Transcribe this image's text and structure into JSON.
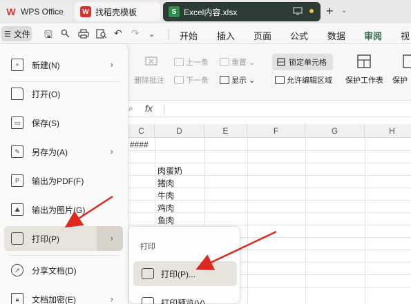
{
  "tabs": {
    "wps": "WPS Office",
    "template": "找稻壳模板",
    "excel": "Excel内容.xlsx",
    "excel_icon": "S",
    "template_icon": "W"
  },
  "toolbar": {
    "file_label": "文件",
    "menus": [
      "开始",
      "插入",
      "页面",
      "公式",
      "数据",
      "审阅",
      "视图"
    ],
    "active_menu": "审阅"
  },
  "ribbon": {
    "delete_comment": "删除批注",
    "prev": "上一条",
    "next": "下一条",
    "reset": "重置",
    "show": "显示",
    "lock_cell": "锁定单元格",
    "allow_edit": "允许编辑区域",
    "protect_sheet": "保护工作表",
    "protect_more": "保护"
  },
  "formula_bar": {
    "fx": "fx"
  },
  "grid": {
    "columns": [
      "C",
      "D",
      "E",
      "F",
      "G",
      "H"
    ],
    "overflow_text": "####",
    "items": [
      "肉蛋奶",
      "猪肉",
      "牛肉",
      "鸡肉",
      "鱼肉"
    ]
  },
  "file_menu": {
    "items": [
      {
        "label": "新建(N)",
        "icon": "new-doc-icon",
        "has_arrow": true
      },
      {
        "label": "打开(O)",
        "icon": "folder-open-icon",
        "has_arrow": false
      },
      {
        "label": "保存(S)",
        "icon": "save-icon",
        "has_arrow": false
      },
      {
        "label": "另存为(A)",
        "icon": "save-as-icon",
        "has_arrow": true
      },
      {
        "label": "输出为PDF(F)",
        "icon": "pdf-export-icon",
        "has_arrow": false
      },
      {
        "label": "输出为图片(G)",
        "icon": "image-export-icon",
        "has_arrow": false
      },
      {
        "label": "打印(P)",
        "icon": "printer-icon",
        "has_arrow": true
      },
      {
        "label": "分享文档(D)",
        "icon": "share-icon",
        "has_arrow": false
      },
      {
        "label": "文档加密(E)",
        "icon": "lock-doc-icon",
        "has_arrow": true
      }
    ]
  },
  "print_submenu": {
    "title": "打印",
    "items": [
      {
        "label": "打印(P)...",
        "icon": "printer-icon"
      },
      {
        "label": "打印预览(V)",
        "icon": "print-preview-icon"
      }
    ]
  },
  "colors": {
    "accent_green": "#2c6b45",
    "arrow_red": "#e0281e",
    "highlight": "#e6e3dd"
  }
}
